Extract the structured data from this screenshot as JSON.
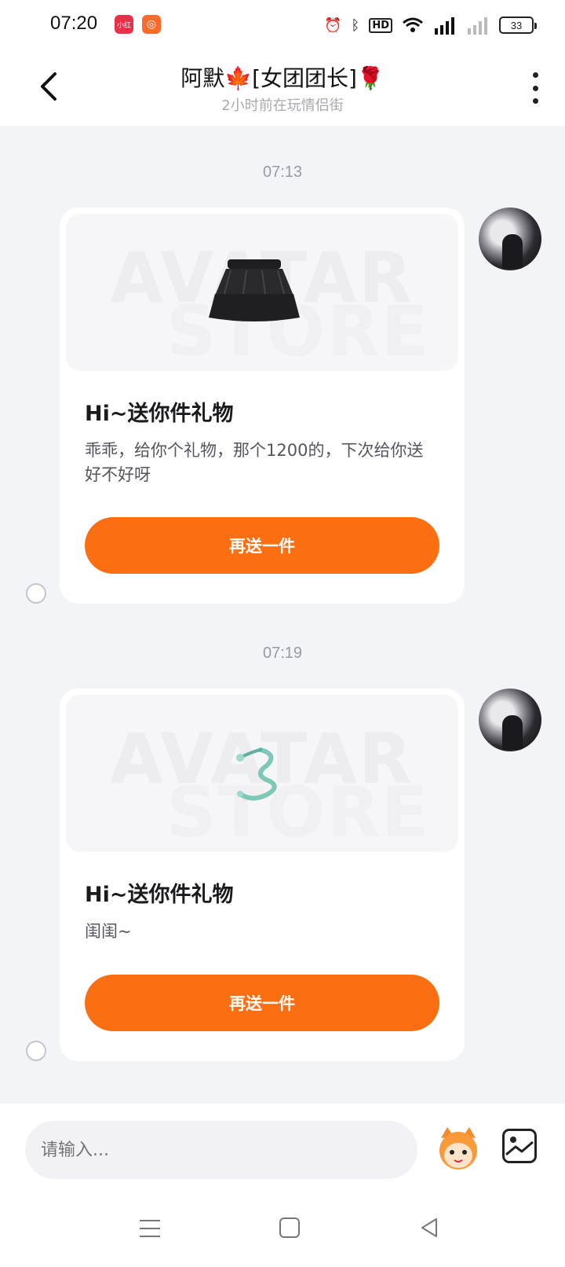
{
  "status_bar": {
    "time": "07:20",
    "app_icons": [
      "xiaohongshu-icon",
      "kuaishou-icon"
    ],
    "battery": "33",
    "indicators": [
      "alarm-icon",
      "bluetooth-icon",
      "hd-icon",
      "wifi-icon",
      "signal-5g-icon",
      "signal-icon"
    ]
  },
  "header": {
    "title": "阿默🍁[女团团长]🌹",
    "subtitle": "2小时前在玩情侣街"
  },
  "messages": [
    {
      "time": "07:13",
      "watermark_line1": "AVATAR",
      "watermark_line2": "STORE",
      "item": "skirt",
      "title": "Hi~送你件礼物",
      "text": "乖乖，给你个礼物，那个1200的，下次给你送好不好呀",
      "button": "再送一件"
    },
    {
      "time": "07:19",
      "watermark_line1": "AVATAR",
      "watermark_line2": "STORE",
      "item": "dragon ring",
      "title": "Hi~送你件礼物",
      "text": "闺闺~",
      "button": "再送一件"
    }
  ],
  "input_bar": {
    "placeholder": "请输入..."
  },
  "colors": {
    "accent": "#fb6e12",
    "background": "#f3f4f8"
  }
}
